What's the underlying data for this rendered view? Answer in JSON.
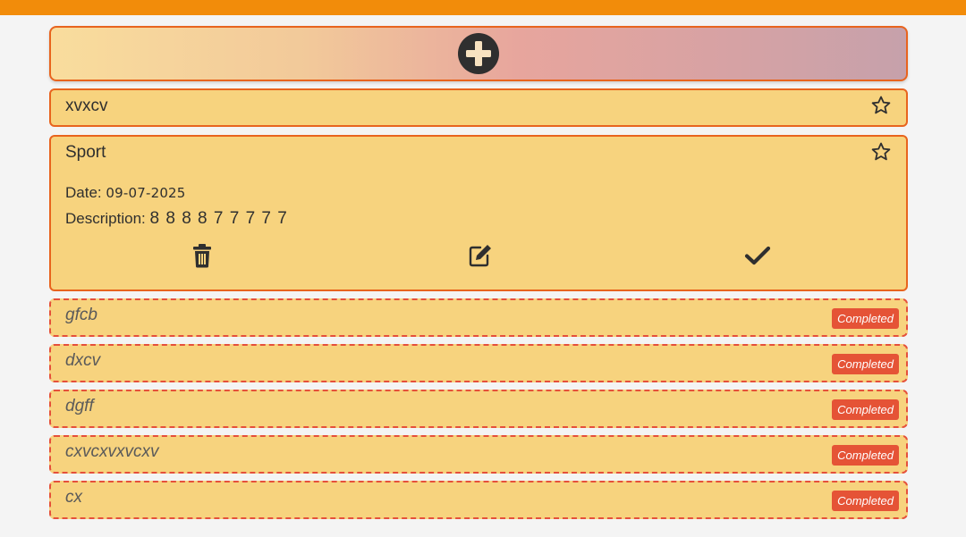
{
  "header": {
    "color": "#f28c0a"
  },
  "add_button": {
    "icon": "plus-circle-icon"
  },
  "todos": [
    {
      "title": "xvxcv",
      "starred": false
    },
    {
      "title": "Sport",
      "starred": false,
      "date_label": "Date:",
      "date": "09-07-2025",
      "description_label": "Description:",
      "description": "8 8 8 8 7 7 7 7 7"
    }
  ],
  "completed": [
    {
      "title": "gfcb",
      "badge": "Completed"
    },
    {
      "title": "dxcv",
      "badge": "Completed"
    },
    {
      "title": "dgff",
      "badge": "Completed"
    },
    {
      "title": "cxvcxvxvcxv",
      "badge": "Completed"
    },
    {
      "title": "cx",
      "badge": "Completed"
    }
  ],
  "colors": {
    "card_bg": "#f7d37e",
    "card_border": "#e8641e",
    "completed_border": "#e5503b",
    "badge_bg": "#e55336"
  }
}
